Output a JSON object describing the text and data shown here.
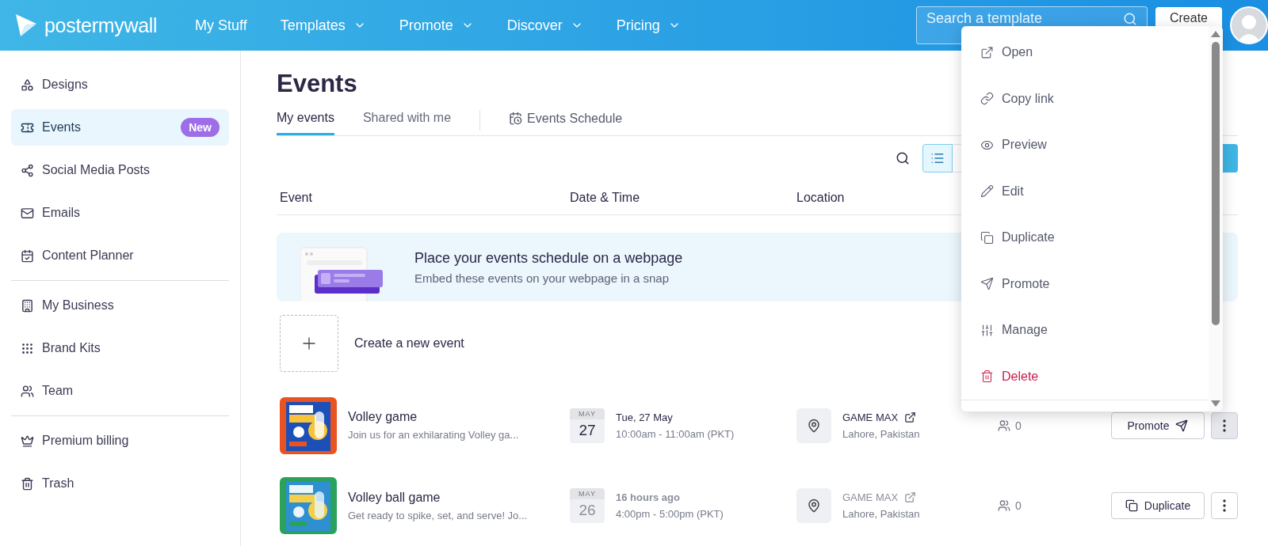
{
  "header": {
    "logo": "postermywall",
    "nav": [
      {
        "label": "My Stuff",
        "dropdown": false
      },
      {
        "label": "Templates",
        "dropdown": true
      },
      {
        "label": "Promote",
        "dropdown": true
      },
      {
        "label": "Discover",
        "dropdown": true
      },
      {
        "label": "Pricing",
        "dropdown": true
      }
    ],
    "search": {
      "placeholder": "Search a template"
    },
    "create_button": "Create"
  },
  "sidebar": {
    "groups": [
      {
        "items": [
          {
            "label": "Designs",
            "selected": false
          },
          {
            "label": "Events",
            "selected": true,
            "badge": "New"
          },
          {
            "label": "Social Media Posts",
            "selected": false
          },
          {
            "label": "Emails",
            "selected": false
          },
          {
            "label": "Content Planner",
            "selected": false
          }
        ]
      },
      {
        "items": [
          {
            "label": "My Business",
            "selected": false
          },
          {
            "label": "Brand Kits",
            "selected": false
          },
          {
            "label": "Team",
            "selected": false
          }
        ]
      },
      {
        "items": [
          {
            "label": "Premium billing",
            "selected": false
          },
          {
            "label": "Trash",
            "selected": false
          }
        ]
      }
    ]
  },
  "page": {
    "title": "Events",
    "tabs": [
      {
        "label": "My events",
        "selected": true
      },
      {
        "label": "Shared with me",
        "selected": false
      }
    ],
    "schedule_link": "Events Schedule",
    "list_view": {
      "selected": true
    },
    "table": {
      "columns": [
        "Event",
        "Date & Time",
        "Location"
      ]
    },
    "banner": {
      "title": "Place your events schedule on a webpage",
      "text": "Embed these events on your webpage in a snap"
    },
    "create_label": "Create a new event",
    "rows": [
      {
        "title": "Volley game",
        "description": "Join us for an exhilarating Volley ga...",
        "month": "MAY",
        "day": "27",
        "date": "Tue, 27 May",
        "time": "10:00am - 11:00am (PKT)",
        "past": false,
        "venue": "GAME MAX",
        "city": "Lahore, Pakistan",
        "attendees": "0",
        "action": {
          "kind": "promote",
          "label": "Promote"
        },
        "menu_open": true
      },
      {
        "title": "Volley ball game",
        "description": "Get ready to spike, set, and serve! Jo...",
        "month": "MAY",
        "day": "26",
        "date": "16 hours ago",
        "time": "4:00pm - 5:00pm (PKT)",
        "past": true,
        "venue": "GAME MAX",
        "city": "Lahore, Pakistan",
        "attendees": "0",
        "action": {
          "kind": "duplicate",
          "label": "Duplicate"
        },
        "menu_open": false
      }
    ]
  },
  "context_menu": {
    "items": [
      {
        "label": "Open",
        "kind": "normal"
      },
      {
        "label": "Copy link",
        "kind": "normal"
      },
      {
        "label": "Preview",
        "kind": "normal"
      },
      {
        "label": "Edit",
        "kind": "normal"
      },
      {
        "label": "Duplicate",
        "kind": "normal"
      },
      {
        "label": "Promote",
        "kind": "normal"
      },
      {
        "label": "Manage",
        "kind": "normal"
      },
      {
        "label": "Delete",
        "kind": "danger"
      }
    ]
  }
}
